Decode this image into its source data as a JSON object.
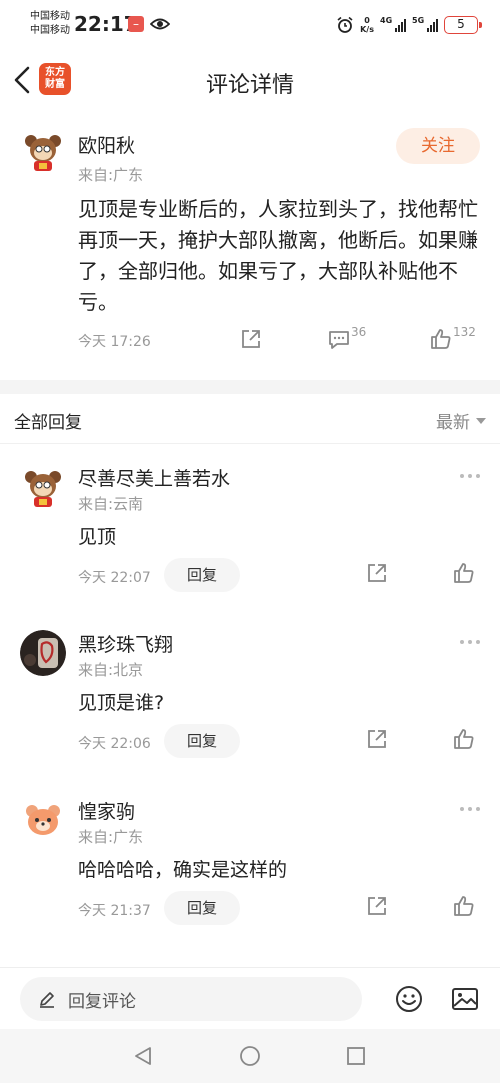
{
  "status_bar": {
    "carrier1": "中国移动",
    "carrier2": "中国移动",
    "time": "22:17",
    "speed_value": "0",
    "speed_unit": "K/s",
    "net1": "4G",
    "net2": "5G",
    "battery": "5"
  },
  "header": {
    "title": "评论详情",
    "logo_text_line1": "东方",
    "logo_text_line2": "财富"
  },
  "main_comment": {
    "author": "欧阳秋",
    "location": "来自:广东",
    "follow_label": "关注",
    "content": "见顶是专业断后的，人家拉到头了，找他帮忙再顶一天，掩护大部队撤离，他断后。如果赚了，全部归他。如果亏了，大部队补贴他不亏。",
    "time": "今天 17:26",
    "comment_count": "36",
    "like_count": "132"
  },
  "replies_header": {
    "title": "全部回复",
    "sort_label": "最新"
  },
  "replies": [
    {
      "author": "尽善尽美上善若水",
      "location": "来自:云南",
      "text": "见顶",
      "time": "今天 22:07",
      "reply_label": "回复"
    },
    {
      "author": "黑珍珠飞翔",
      "location": "来自:北京",
      "text": "见顶是谁?",
      "time": "今天 22:06",
      "reply_label": "回复"
    },
    {
      "author": "惶家驹",
      "location": "来自:广东",
      "text": "哈哈哈哈，确实是这样的",
      "time": "今天 21:37",
      "reply_label": "回复"
    }
  ],
  "input_bar": {
    "placeholder": "回复评论"
  },
  "colors": {
    "accent": "#e8692f",
    "follow_bg": "#fdeee4",
    "brand": "#e8512a"
  }
}
